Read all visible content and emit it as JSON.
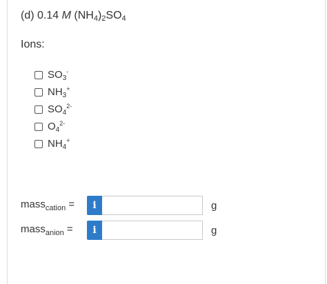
{
  "question": {
    "part": "(d)",
    "concentration": "0.14",
    "unit": "M",
    "formula_prefix": "(NH",
    "formula_sub1": "4",
    "formula_mid": ")",
    "formula_sub2": "2",
    "formula_suffix": "SO",
    "formula_sub3": "4"
  },
  "ions_label": "Ions:",
  "ions": [
    {
      "base": "SO",
      "sub": "3",
      "sup": "-",
      "checked": false
    },
    {
      "base": "NH",
      "sub": "3",
      "sup": "+",
      "checked": false
    },
    {
      "base": "SO",
      "sub": "4",
      "sup": "2-",
      "checked": false
    },
    {
      "base": "O",
      "sub": "4",
      "sup": "2-",
      "checked": false
    },
    {
      "base": "NH",
      "sub": "4",
      "sup": "+",
      "checked": false
    }
  ],
  "mass_rows": [
    {
      "label": "mass",
      "sub": "cation",
      "eq": " =",
      "value": "",
      "unit": "g",
      "info": "i"
    },
    {
      "label": "mass",
      "sub": "anion",
      "eq": " =",
      "value": "",
      "unit": "g",
      "info": "i"
    }
  ],
  "colors": {
    "info_button": "#2e7cc9"
  }
}
